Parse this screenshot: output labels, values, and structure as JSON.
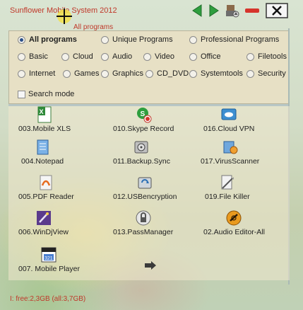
{
  "window": {
    "title": "Sunflower Mobile System 2012",
    "breadcrumb": "All programs",
    "status": "I:  free:2,3GB (all:3,7GB)"
  },
  "filters": {
    "row1": [
      {
        "label": "All programs",
        "checked": true
      },
      {
        "label": "Unique Programs",
        "checked": false
      },
      {
        "label": "Professional Programs",
        "checked": false
      }
    ],
    "row2": [
      {
        "label": "Basic",
        "checked": false
      },
      {
        "label": "Cloud",
        "checked": false
      },
      {
        "label": "Audio",
        "checked": false
      },
      {
        "label": "Video",
        "checked": false
      },
      {
        "label": "Office",
        "checked": false
      },
      {
        "label": "Filetools",
        "checked": false
      }
    ],
    "row3": [
      {
        "label": "Internet",
        "checked": false
      },
      {
        "label": "Games",
        "checked": false
      },
      {
        "label": "Graphics",
        "checked": false
      },
      {
        "label": "CD_DVD",
        "checked": false
      },
      {
        "label": "Systemtools",
        "checked": false
      },
      {
        "label": "Security",
        "checked": false
      }
    ],
    "search_mode": "Search mode"
  },
  "apps": [
    {
      "label": "003.Mobile XLS",
      "icon": "excel-icon"
    },
    {
      "label": "010.Skype Record",
      "icon": "skype-record-icon"
    },
    {
      "label": "016.Cloud VPN",
      "icon": "cloud-vpn-icon"
    },
    {
      "label": "004.Notepad",
      "icon": "notepad-icon"
    },
    {
      "label": "011.Backup.Sync",
      "icon": "backup-drive-icon"
    },
    {
      "label": "017.VirusScanner",
      "icon": "virus-scanner-icon"
    },
    {
      "label": "005.PDF Reader",
      "icon": "pdf-icon"
    },
    {
      "label": "012.USBencryption",
      "icon": "usb-encryption-icon"
    },
    {
      "label": "019.File Killer",
      "icon": "file-killer-icon"
    },
    {
      "label": "006.WinDjView",
      "icon": "windjview-icon"
    },
    {
      "label": "013.PassManager",
      "icon": "lock-icon"
    },
    {
      "label": "02.Audio Editor-All",
      "icon": "audio-editor-icon"
    },
    {
      "label": "007. Mobile Player",
      "icon": "media-player-icon"
    }
  ],
  "colors": {
    "accent_red": "#c0392b",
    "nav_green": "#2e9e3e",
    "panel_bg": "#e8e0c4"
  }
}
